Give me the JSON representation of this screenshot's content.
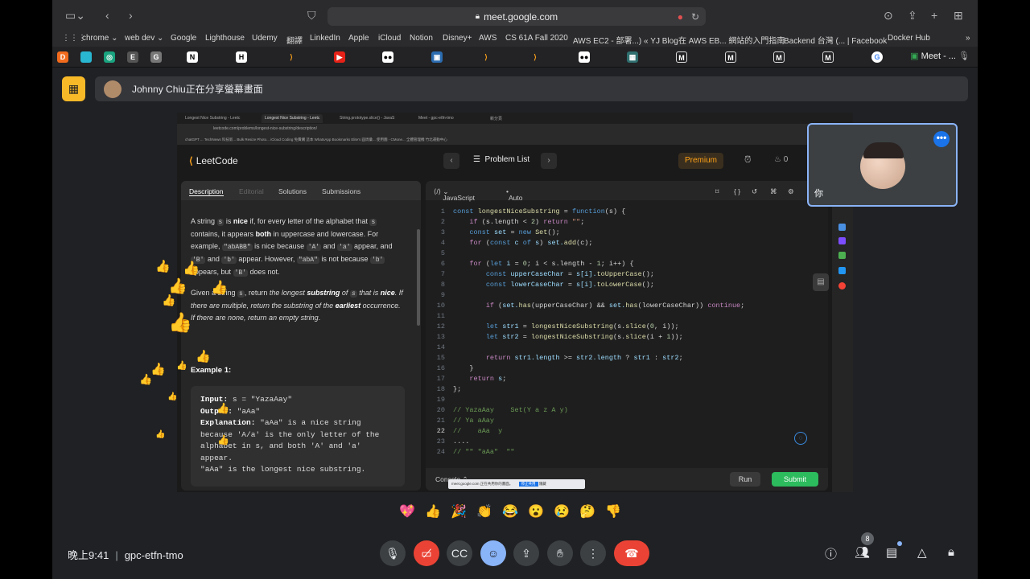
{
  "browser": {
    "url": "meet.google.com",
    "bookmarks": [
      "chrome ⌄",
      "web dev ⌄",
      "Google",
      "Lighthouse",
      "Udemy",
      "翻譯",
      "LinkedIn",
      "Apple",
      "iCloud",
      "Notion",
      "Disney+",
      "AWS",
      "CS 61A Fall 2020",
      "AWS EC2 - 部署...) « YJ Blog",
      "在 AWS EB... 網站的入門指南",
      "Backend 台灣 (... | Facebook",
      "Docker Hub"
    ],
    "active_tab": "Meet - ..."
  },
  "share": {
    "banner_text": "Johnny Chiu正在分享螢幕畫面"
  },
  "inner_browser": {
    "tabs": [
      "Longest Nice Substring - Leetc",
      "Longest Nice Substring - Leetc",
      "String.prototype.slice() - JavaS",
      "Meet - gpc-etfn-tmo",
      "新分頁"
    ],
    "url": "leetcode.com/problems/longest-nice-substring/description/",
    "bookmarks": "chatGPT   ...   TechNews 科技新...   Bulk Resize Photo...   iCloud   Coding   免費購   這本   WhatsApp   Bookmarks   Elite's 圓周彙...   使用圖 - CMone...   全體管理機   竹北運動中心"
  },
  "leetcode": {
    "logo": "LeetCode",
    "problem_list": "Problem List",
    "premium": "Premium",
    "streak": "0",
    "desc_tabs": [
      "Description",
      "Editorial",
      "Solutions",
      "Submissions"
    ],
    "lang": "JavaScript",
    "auto": "Auto",
    "example_title": "Example 1:",
    "example": {
      "input_label": "Input:",
      "input": "s = \"YazaAay\"",
      "output_label": "Output:",
      "output": "\"aAa\"",
      "explanation_label": "Explanation:",
      "explanation_1": "\"aAa\" is a nice string",
      "explanation_2": "because 'A/a' is the only letter of the",
      "explanation_3": "alphabet in s, and both 'A' and 'a'",
      "explanation_4": "appear.",
      "explanation_5": "\"aAa\" is the longest nice substring."
    },
    "console": "Console ⌃",
    "run": "Run",
    "submit": "Submit",
    "share_toast": "meet.google.com 正在共用你的畫面。",
    "share_stop": "停止共用",
    "share_hide": "隱藏"
  },
  "self_view": {
    "label": "你"
  },
  "emojis": [
    "💖",
    "👍",
    "🎉",
    "👏",
    "😂",
    "😮",
    "😢",
    "🤔",
    "👎"
  ],
  "meeting": {
    "time": "晚上9:41",
    "code": "gpc-etfn-tmo",
    "participant_count": "8"
  }
}
